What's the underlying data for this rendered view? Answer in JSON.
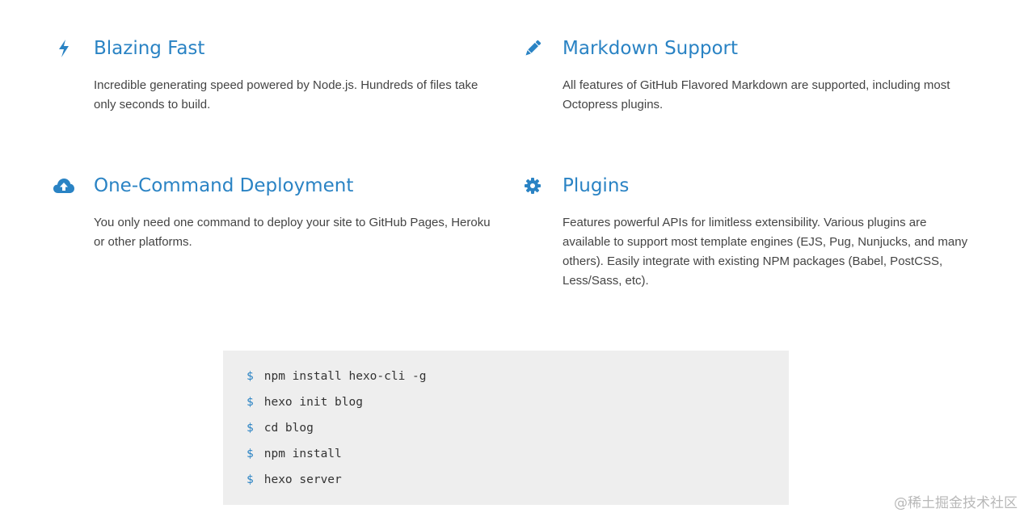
{
  "features": [
    {
      "icon": "bolt-icon",
      "title": "Blazing Fast",
      "description": "Incredible generating speed powered by Node.js. Hundreds of files take only seconds to build."
    },
    {
      "icon": "pencil-icon",
      "title": "Markdown Support",
      "description": "All features of GitHub Flavored Markdown are supported, including most Octopress plugins."
    },
    {
      "icon": "cloud-upload-icon",
      "title": "One-Command Deployment",
      "description": "You only need one command to deploy your site to GitHub Pages, Heroku or other platforms."
    },
    {
      "icon": "gear-icon",
      "title": "Plugins",
      "description": "Features powerful APIs for limitless extensibility. Various plugins are available to support most template engines (EJS, Pug, Nunjucks, and many others). Easily integrate with existing NPM packages (Babel, PostCSS, Less/Sass, etc)."
    }
  ],
  "terminal": {
    "prompt": "$",
    "lines": [
      "npm install hexo-cli -g",
      "hexo init blog",
      "cd blog",
      "npm install",
      "hexo server"
    ]
  },
  "watermark": "@稀土掘金技术社区",
  "colors": {
    "accent": "#2a83c4",
    "text": "#444444",
    "terminal_bg": "#eeeeee"
  }
}
